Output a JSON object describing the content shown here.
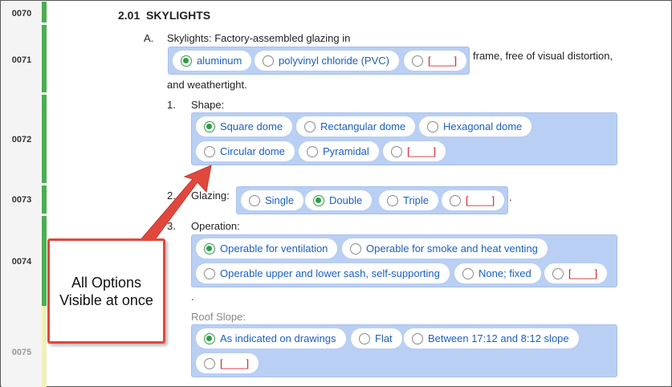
{
  "gutter": {
    "lines": [
      "0070",
      "0071",
      "0072",
      "0073",
      "0074",
      "0075"
    ]
  },
  "section": {
    "number": "2.01",
    "title": "SKYLIGHTS"
  },
  "paragraph_a": {
    "label": "A.",
    "intro": "Skylights:  Factory-assembled glazing in",
    "trailing": "frame, free of visual distortion,",
    "continuation": "and weathertight.",
    "options": [
      {
        "label": "aluminum",
        "selected": true
      },
      {
        "label": "polyvinyl chloride (PVC)",
        "selected": false
      },
      {
        "label": "[____]",
        "selected": false
      }
    ]
  },
  "shape": {
    "label": "1.",
    "title": "Shape:",
    "options": [
      {
        "label": "Square dome",
        "selected": true
      },
      {
        "label": "Rectangular dome",
        "selected": false
      },
      {
        "label": "Hexagonal dome",
        "selected": false
      },
      {
        "label": "Circular dome",
        "selected": false
      },
      {
        "label": "Pyramidal",
        "selected": false
      },
      {
        "label": "[____]",
        "selected": false
      }
    ]
  },
  "glazing": {
    "label": "2.",
    "title": "Glazing:",
    "trailing": ".",
    "options": [
      {
        "label": "Single",
        "selected": false
      },
      {
        "label": "Double",
        "selected": true
      },
      {
        "label": "Triple",
        "selected": false
      },
      {
        "label": "[____]",
        "selected": false
      }
    ]
  },
  "operation": {
    "label": "3.",
    "title": "Operation:",
    "trailing": ".",
    "options": [
      {
        "label": "Operable for ventilation",
        "selected": true
      },
      {
        "label": "Operable for smoke and heat venting",
        "selected": false
      },
      {
        "label": "Operable upper and lower sash, self-supporting",
        "selected": false
      },
      {
        "label": "None; fixed",
        "selected": false
      },
      {
        "label": "[____]",
        "selected": false
      }
    ]
  },
  "roof_slope": {
    "title": "Roof Slope:",
    "options": [
      {
        "label": "As indicated on drawings",
        "selected": true
      },
      {
        "label": "Flat",
        "selected": false
      },
      {
        "label": "Between 17:12 and 8:12 slope",
        "selected": false
      },
      {
        "label": "[____]",
        "selected": false
      }
    ]
  },
  "callout": {
    "text_line1": "All Options",
    "text_line2": "Visible at once"
  },
  "colors": {
    "group_bg": "#b9cff3",
    "option_text": "#1a5fc4",
    "selected_radio": "#2e9b47",
    "blank_text": "#d0202a",
    "callout_border": "#e0473d",
    "gutter_bar": "#4caf50"
  }
}
